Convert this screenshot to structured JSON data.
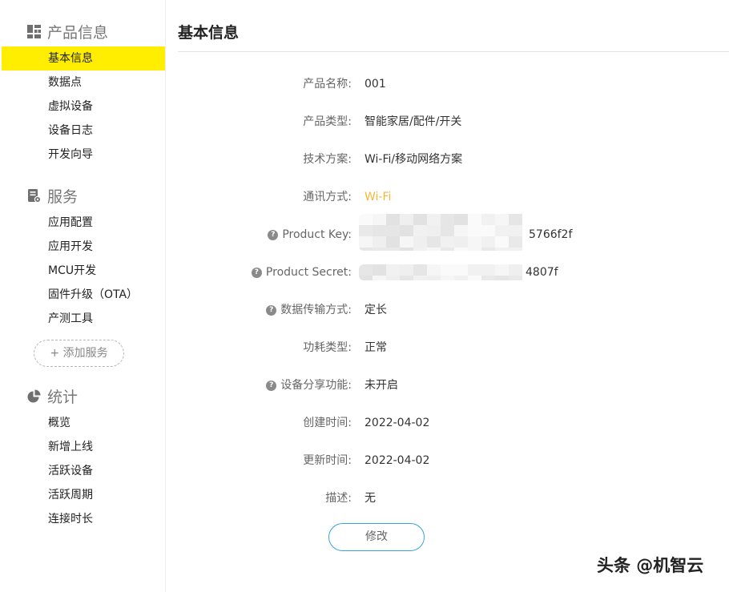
{
  "sidebar": {
    "sections": [
      {
        "title": "产品信息",
        "icon": "grid-icon",
        "items": [
          "基本信息",
          "数据点",
          "虚拟设备",
          "设备日志",
          "开发向导"
        ]
      },
      {
        "title": "服务",
        "icon": "service-icon",
        "items": [
          "应用配置",
          "应用开发",
          "MCU开发",
          "固件升级（OTA）",
          "产测工具"
        ]
      },
      {
        "title": "统计",
        "icon": "pie-chart-icon",
        "items": [
          "概览",
          "新增上线",
          "活跃设备",
          "活跃周期",
          "连接时长"
        ]
      }
    ],
    "add_service_label": "+ 添加服务",
    "active_item": "基本信息"
  },
  "main": {
    "title": "基本信息",
    "fields": {
      "product_name": {
        "label": "产品名称:",
        "value": "001"
      },
      "product_type": {
        "label": "产品类型:",
        "value": "智能家居/配件/开关"
      },
      "tech_solution": {
        "label": "技术方案:",
        "value": "Wi-Fi/移动网络方案"
      },
      "comm_method": {
        "label": "通讯方式:",
        "value": "Wi-Fi"
      },
      "product_key": {
        "label": "Product Key:",
        "value_visible_tail": "5766f2f"
      },
      "product_secret": {
        "label": "Product Secret:",
        "value_visible_tail": "4807f"
      },
      "data_transfer": {
        "label": "数据传输方式:",
        "value": "定长"
      },
      "power_type": {
        "label": "功耗类型:",
        "value": "正常"
      },
      "device_share": {
        "label": "设备分享功能:",
        "value": "未开启"
      },
      "created_time": {
        "label": "创建时间:",
        "value": "2022-04-02"
      },
      "updated_time": {
        "label": "更新时间:",
        "value": "2022-04-02"
      },
      "description": {
        "label": "描述:",
        "value": "无"
      }
    },
    "edit_label": "修改"
  },
  "watermark": "头条 @机智云",
  "colors": {
    "active_nav": "#ffee00",
    "accent_value": "#f5b63a",
    "button_border": "#3aa3d8"
  }
}
